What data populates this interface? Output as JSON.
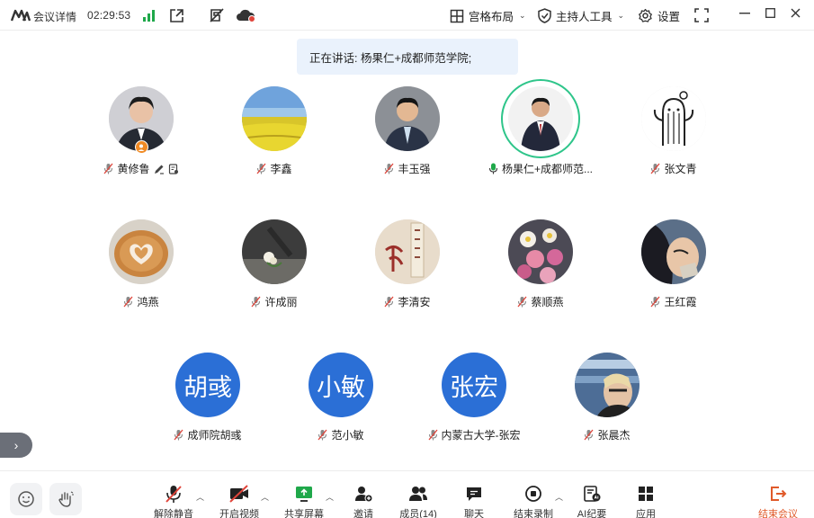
{
  "topbar": {
    "meeting_info_label": "会议详情",
    "timer": "02:29:53",
    "layout_label": "宫格布局",
    "host_tools_label": "主持人工具",
    "settings_label": "设置"
  },
  "speaking_banner": "正在讲话: 杨果仁+成都师范学院;",
  "participants": [
    {
      "name": "黄修鲁",
      "avatar": "photo",
      "muted": true,
      "host": true
    },
    {
      "name": "李鑫",
      "avatar": "photo",
      "muted": true
    },
    {
      "name": "丰玉强",
      "avatar": "photo",
      "muted": true
    },
    {
      "name": "杨果仁+成都师范...",
      "avatar": "photo",
      "muted": false,
      "speaking": true
    },
    {
      "name": "张文青",
      "avatar": "photo",
      "muted": true
    },
    {
      "name": "鸿燕",
      "avatar": "photo",
      "muted": true
    },
    {
      "name": "许成丽",
      "avatar": "photo",
      "muted": true
    },
    {
      "name": "李清安",
      "avatar": "photo",
      "muted": true
    },
    {
      "name": "蔡顺燕",
      "avatar": "photo",
      "muted": true
    },
    {
      "name": "王红霞",
      "avatar": "photo",
      "muted": true
    },
    {
      "name": "成师院胡彧",
      "avatar": "text",
      "avatar_text": "胡彧",
      "muted": true
    },
    {
      "name": "范小敏",
      "avatar": "text",
      "avatar_text": "小敏",
      "muted": true
    },
    {
      "name": "内蒙古大学-张宏",
      "avatar": "text",
      "avatar_text": "张宏",
      "muted": true
    },
    {
      "name": "张晨杰",
      "avatar": "photo",
      "muted": true
    }
  ],
  "controls": {
    "unmute": "解除静音",
    "start_video": "开启视频",
    "share_screen": "共享屏幕",
    "invite": "邀请",
    "members": "成员(14)",
    "chat": "聊天",
    "stop_recording": "结束录制",
    "ai_notes": "AI纪要",
    "apps": "应用",
    "end_meeting": "结束会议"
  },
  "colors": {
    "accent_blue": "#2b6fd6",
    "speaking_ring": "#2ec58a",
    "end_red": "#e05a2a",
    "signal_green": "#1fa84a",
    "banner_bg": "#eaf2fc"
  }
}
